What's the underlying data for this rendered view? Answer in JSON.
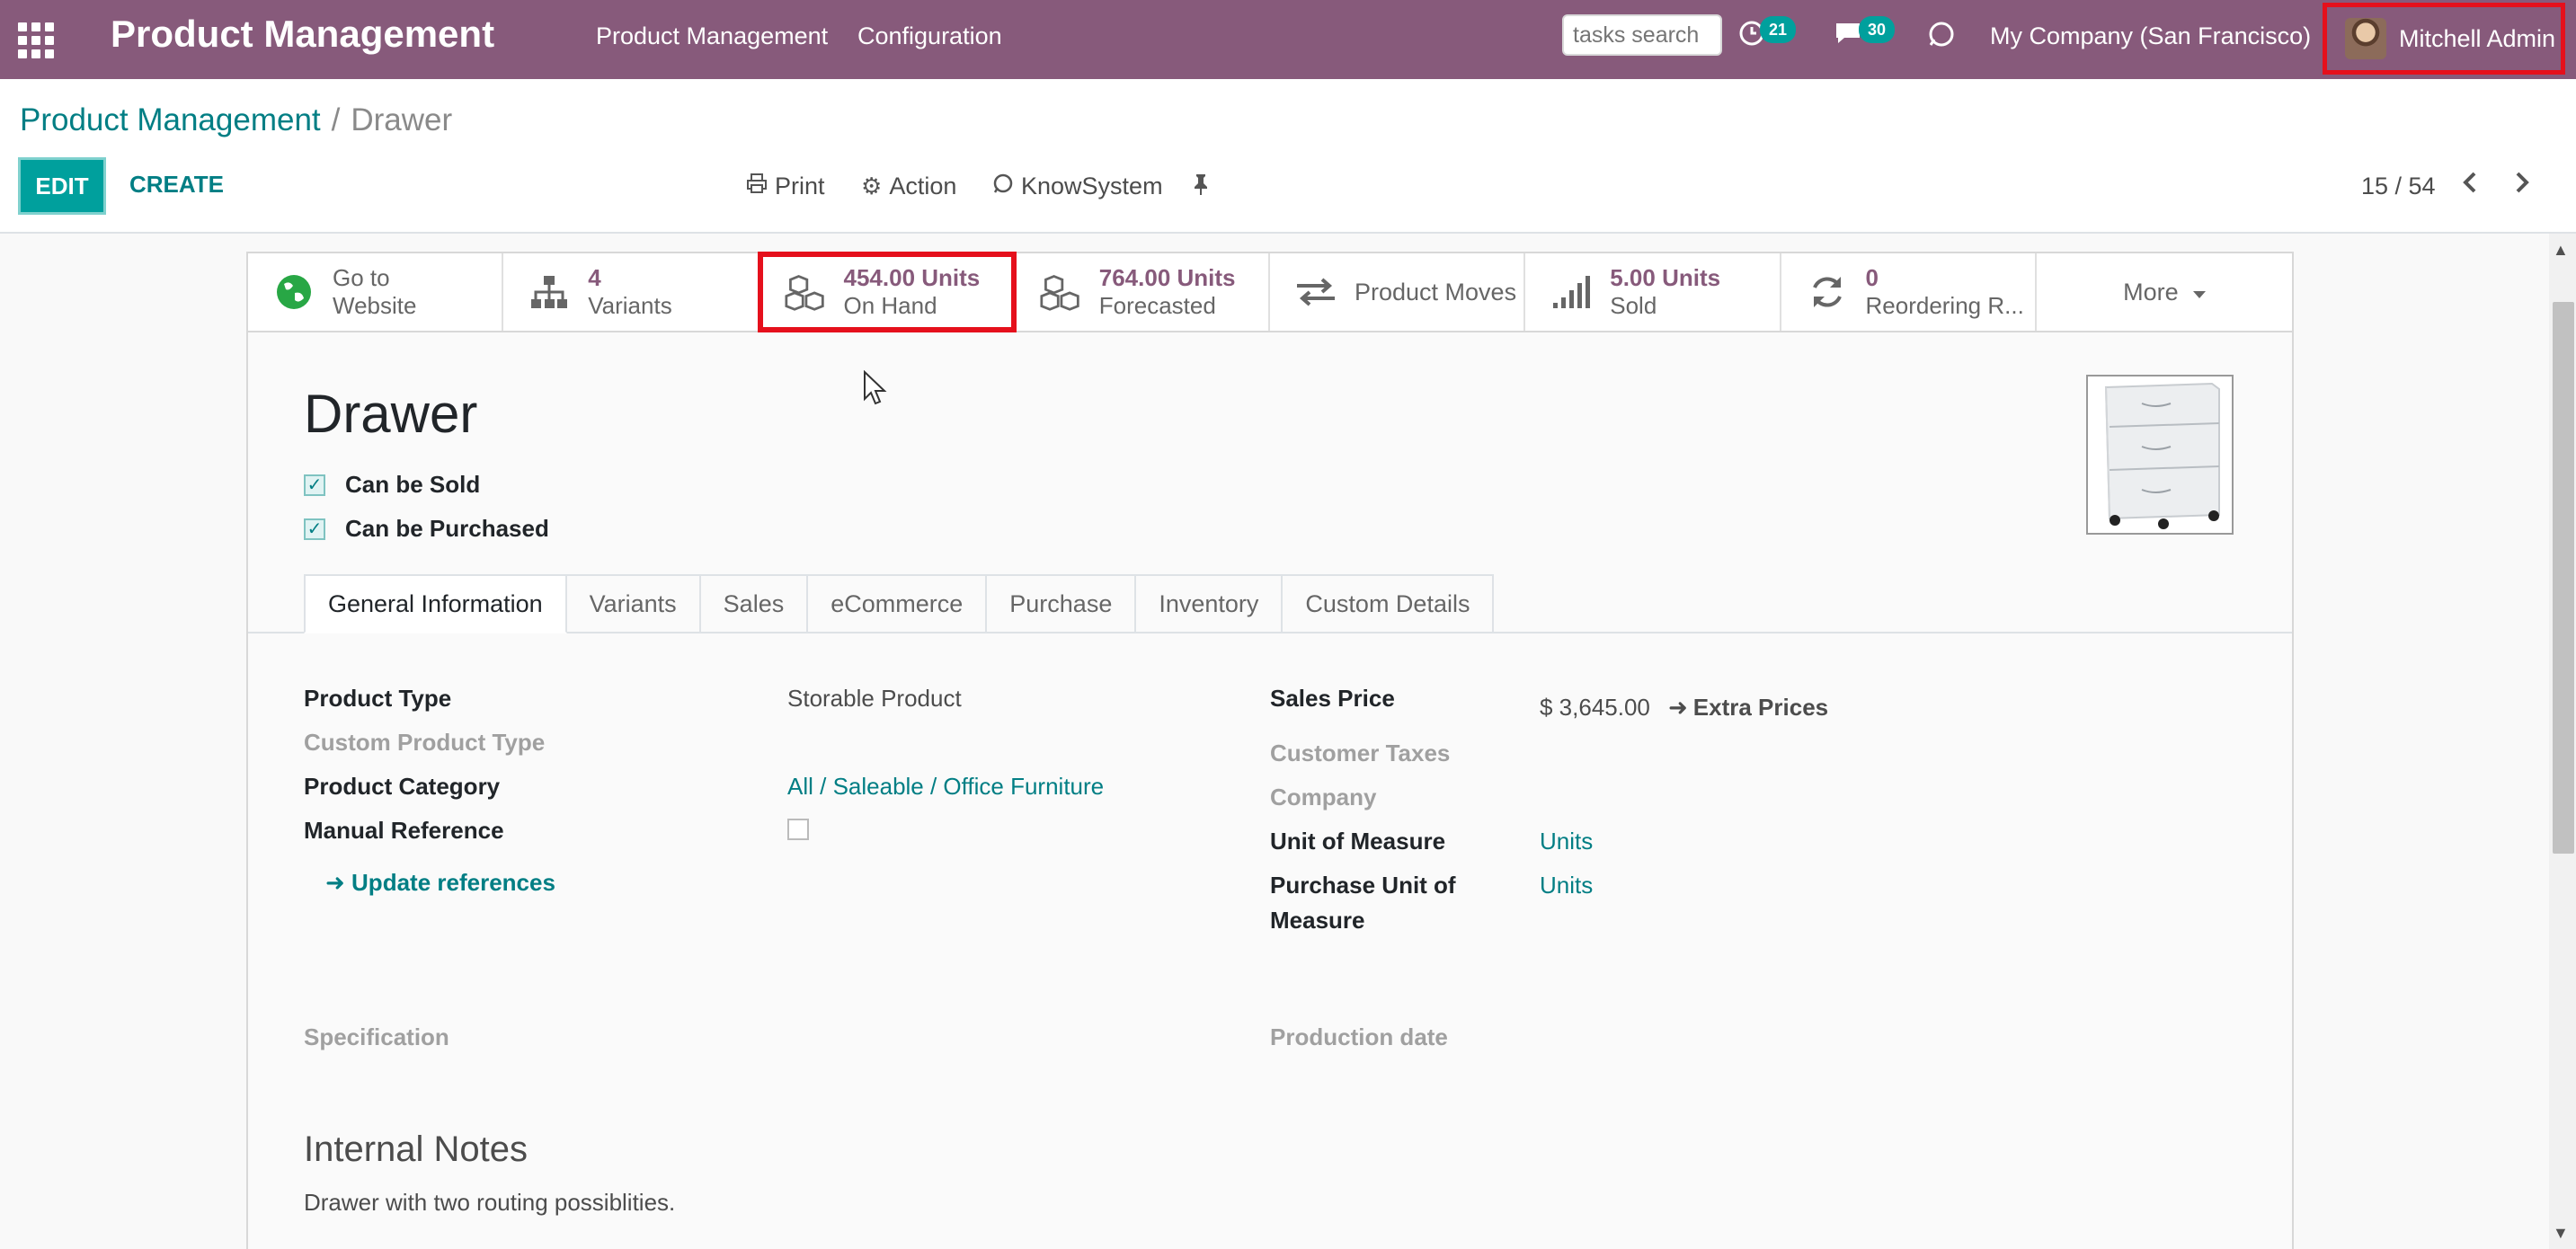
{
  "navbar": {
    "brand": "Product Management",
    "menu": [
      "Product Management",
      "Configuration"
    ],
    "search_placeholder": "tasks search",
    "activity_badge": "21",
    "messages_badge": "30",
    "company": "My Company (San Francisco)",
    "user": "Mitchell Admin",
    "bg_color": "#875a7b"
  },
  "breadcrumb": {
    "parent": "Product Management",
    "separator": "/",
    "current": "Drawer"
  },
  "control_panel": {
    "edit": "EDIT",
    "create": "CREATE",
    "print": "Print",
    "action": "Action",
    "knowsystem": "KnowSystem",
    "pager": "15 / 54"
  },
  "smart_buttons": {
    "website": {
      "line1": "Go to",
      "line2": "Website"
    },
    "variants": {
      "value": "4",
      "label": "Variants"
    },
    "on_hand": {
      "value": "454.00 Units",
      "label": "On Hand"
    },
    "forecasted": {
      "value": "764.00 Units",
      "label": "Forecasted"
    },
    "moves": {
      "label": "Product Moves"
    },
    "sold": {
      "value": "5.00 Units",
      "label": "Sold"
    },
    "reordering": {
      "value": "0",
      "label": "Reordering R..."
    },
    "more": "More"
  },
  "product": {
    "name": "Drawer",
    "can_be_sold": "Can be Sold",
    "can_be_purchased": "Can be Purchased"
  },
  "tabs": [
    "General Information",
    "Variants",
    "Sales",
    "eCommerce",
    "Purchase",
    "Inventory",
    "Custom Details"
  ],
  "fields": {
    "product_type_label": "Product Type",
    "product_type_value": "Storable Product",
    "custom_product_type_label": "Custom Product Type",
    "product_category_label": "Product Category",
    "product_category_value": "All / Saleable / Office Furniture",
    "manual_reference_label": "Manual Reference",
    "update_references": "Update references",
    "sales_price_label": "Sales Price",
    "sales_price_value": "$ 3,645.00",
    "extra_prices": "Extra Prices",
    "customer_taxes_label": "Customer Taxes",
    "company_label": "Company",
    "uom_label": "Unit of Measure",
    "uom_value": "Units",
    "purchase_uom_label_1": "Purchase Unit of",
    "purchase_uom_label_2": "Measure",
    "purchase_uom_value": "Units",
    "specification_label": "Specification",
    "production_date_label": "Production date"
  },
  "notes": {
    "title": "Internal Notes",
    "text": "Drawer with two routing possiblities."
  }
}
